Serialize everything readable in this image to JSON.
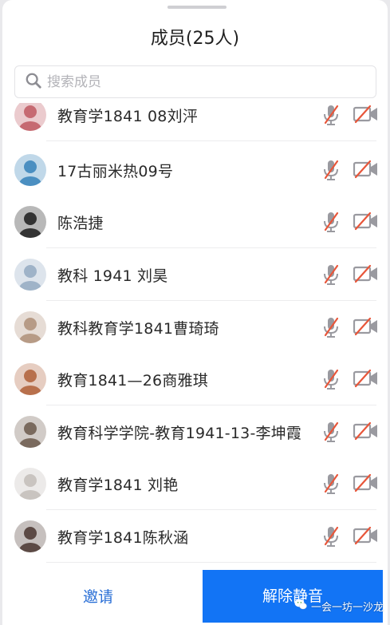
{
  "header": {
    "title": "成员(25人)"
  },
  "search": {
    "placeholder": "搜索成员"
  },
  "members": [
    {
      "name": "教育学1841 08刘泙",
      "avatar_color": "#c66a72",
      "mic": "muted",
      "camera": "off"
    },
    {
      "name": "17古丽米热09号",
      "avatar_color": "#4b8fc1",
      "mic": "muted",
      "camera": "off"
    },
    {
      "name": "陈浩捷",
      "avatar_color": "#333333",
      "mic": "muted",
      "camera": "off"
    },
    {
      "name": "教科 1941 刘昊",
      "avatar_color": "#9fb3c8",
      "mic": "muted",
      "camera": "off"
    },
    {
      "name": "教科教育学1841曹琦琦",
      "avatar_color": "#b79b86",
      "mic": "muted",
      "camera": "off"
    },
    {
      "name": "教育1841—26商雅琪",
      "avatar_color": "#b8704c",
      "mic": "muted",
      "camera": "off"
    },
    {
      "name": "教育科学学院-教育1941-13-李坤霞",
      "avatar_color": "#7a6a5e",
      "mic": "muted",
      "camera": "off"
    },
    {
      "name": "教育学1841  刘艳",
      "avatar_color": "#c9c4c0",
      "mic": "muted",
      "camera": "off"
    },
    {
      "name": "教育学1841陈秋涵",
      "avatar_color": "#5c4a45",
      "mic": "muted",
      "camera": "off"
    }
  ],
  "footer": {
    "invite_label": "邀请",
    "unmute_label": "解除静音"
  },
  "watermark": {
    "text": "一会一坊一沙龙"
  },
  "colors": {
    "accent": "#1274f5",
    "link": "#2a6fd6",
    "muted_slash": "#e8563a",
    "icon_gray": "#9a9aa0"
  }
}
